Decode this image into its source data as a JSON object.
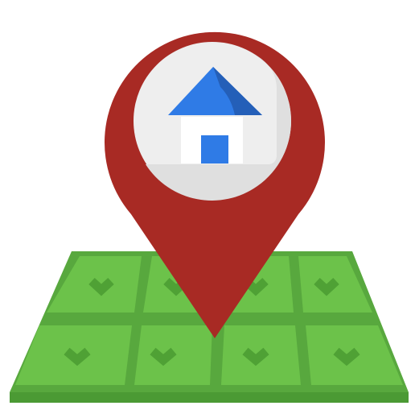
{
  "icon": {
    "name": "home-location-map-icon",
    "parts": [
      "map-ground-icon",
      "location-pin-icon",
      "home-icon"
    ]
  },
  "colors": {
    "background": "#ffffff",
    "map_base": "#58A83E",
    "map_tile": "#6CC24A",
    "map_grid": "#4E9B35",
    "map_front_edge": "#4B9A34",
    "map_chevron": "#4FA135",
    "pin_red": "#A82A24",
    "pin_circle": "#EEEEEE",
    "pin_circle_shade": "#DFDFDF",
    "roof_blue": "#2F7BE6",
    "roof_shade": "#245FB8",
    "house_wall": "#FFFFFF",
    "door_blue": "#2F7BE6"
  }
}
